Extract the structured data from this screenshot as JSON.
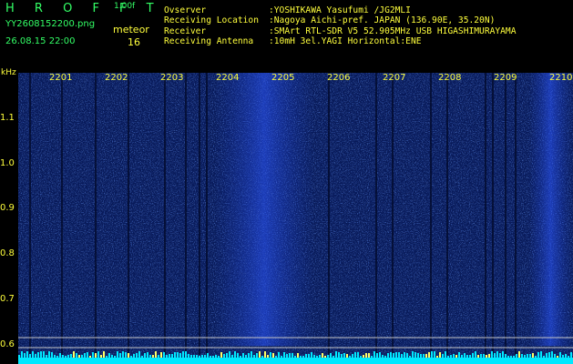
{
  "header": {
    "brand": "H R O F F T",
    "version": "1.00f",
    "filename": "YY2608152200.png",
    "meteor_label": "meteor",
    "meteor_count": "16",
    "datetime": "26.08.15 22:00",
    "observer_label": "Ovserver",
    "observer_value": ":YOSHIKAWA Yasufumi /JG2MLI",
    "location_label": "Receiving Location",
    "location_value": ":Nagoya Aichi-pref. JAPAN (136.90E, 35.20N)",
    "receiver_label": "Receiver",
    "receiver_value": ":SMArt RTL-SDR V5 52.905MHz USB HIGASHIMURAYAMA",
    "antenna_label": "Receiving Antenna",
    "antenna_value": ":10mH 3el.YAGI Horizontal:ENE"
  },
  "axis": {
    "y_unit": "kHz",
    "y_ticks": [
      "1.1",
      "1.0",
      "0.9",
      "0.8",
      "0.7",
      "0.6"
    ],
    "x_ticks": [
      "2201",
      "2202",
      "2203",
      "2204",
      "2205",
      "2206",
      "2207",
      "2208",
      "2209",
      "2210"
    ]
  },
  "colors": {
    "background": "#000000",
    "text_yellow": "#ffff3c",
    "text_green": "#33ff66",
    "spectrogram_base": "#0a1e63",
    "noise_bright": "#6fa0ff",
    "baseline_cyan": "#00ffff"
  }
}
